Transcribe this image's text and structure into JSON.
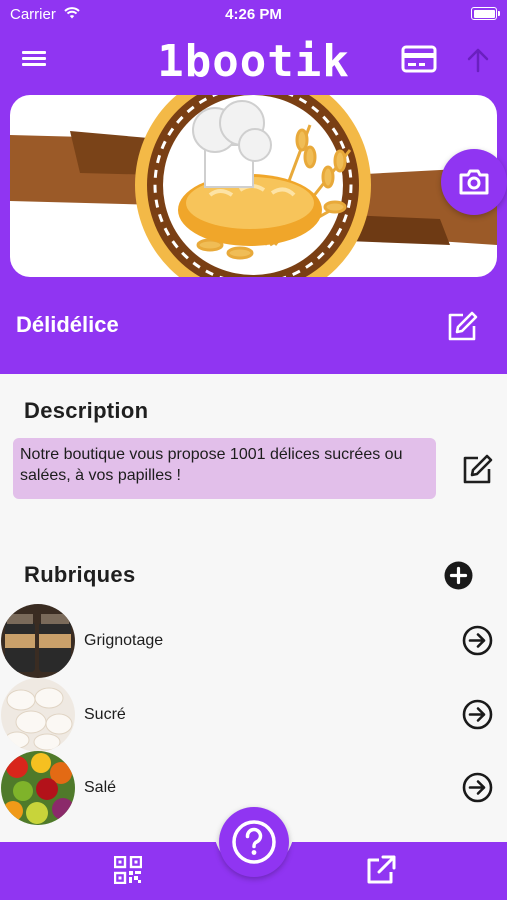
{
  "status_bar": {
    "carrier": "Carrier",
    "time": "4:26 PM"
  },
  "header": {
    "title": "1bootik",
    "menu_icon": "hamburger-menu-icon",
    "card_icon": "credit-card-icon",
    "up_icon": "arrow-up-icon"
  },
  "banner": {
    "camera_icon": "camera-icon"
  },
  "shop": {
    "name": "Délidélice",
    "edit_icon": "edit-icon"
  },
  "description": {
    "title": "Description",
    "text": "Notre boutique vous propose 1001 délices sucrées ou salées, à vos papilles !",
    "edit_icon": "edit-icon"
  },
  "rubriques": {
    "title": "Rubriques",
    "add_icon": "plus-circle-icon",
    "items": [
      {
        "label": "Grignotage"
      },
      {
        "label": "Sucré"
      },
      {
        "label": "Salé"
      }
    ]
  },
  "bottom_bar": {
    "qr_icon": "qr-code-icon",
    "help_icon": "help-circle-icon",
    "share_icon": "external-link-icon"
  },
  "colors": {
    "primary": "#9035f2",
    "description_bg": "#e2bfea",
    "background": "#f7f7f7"
  }
}
